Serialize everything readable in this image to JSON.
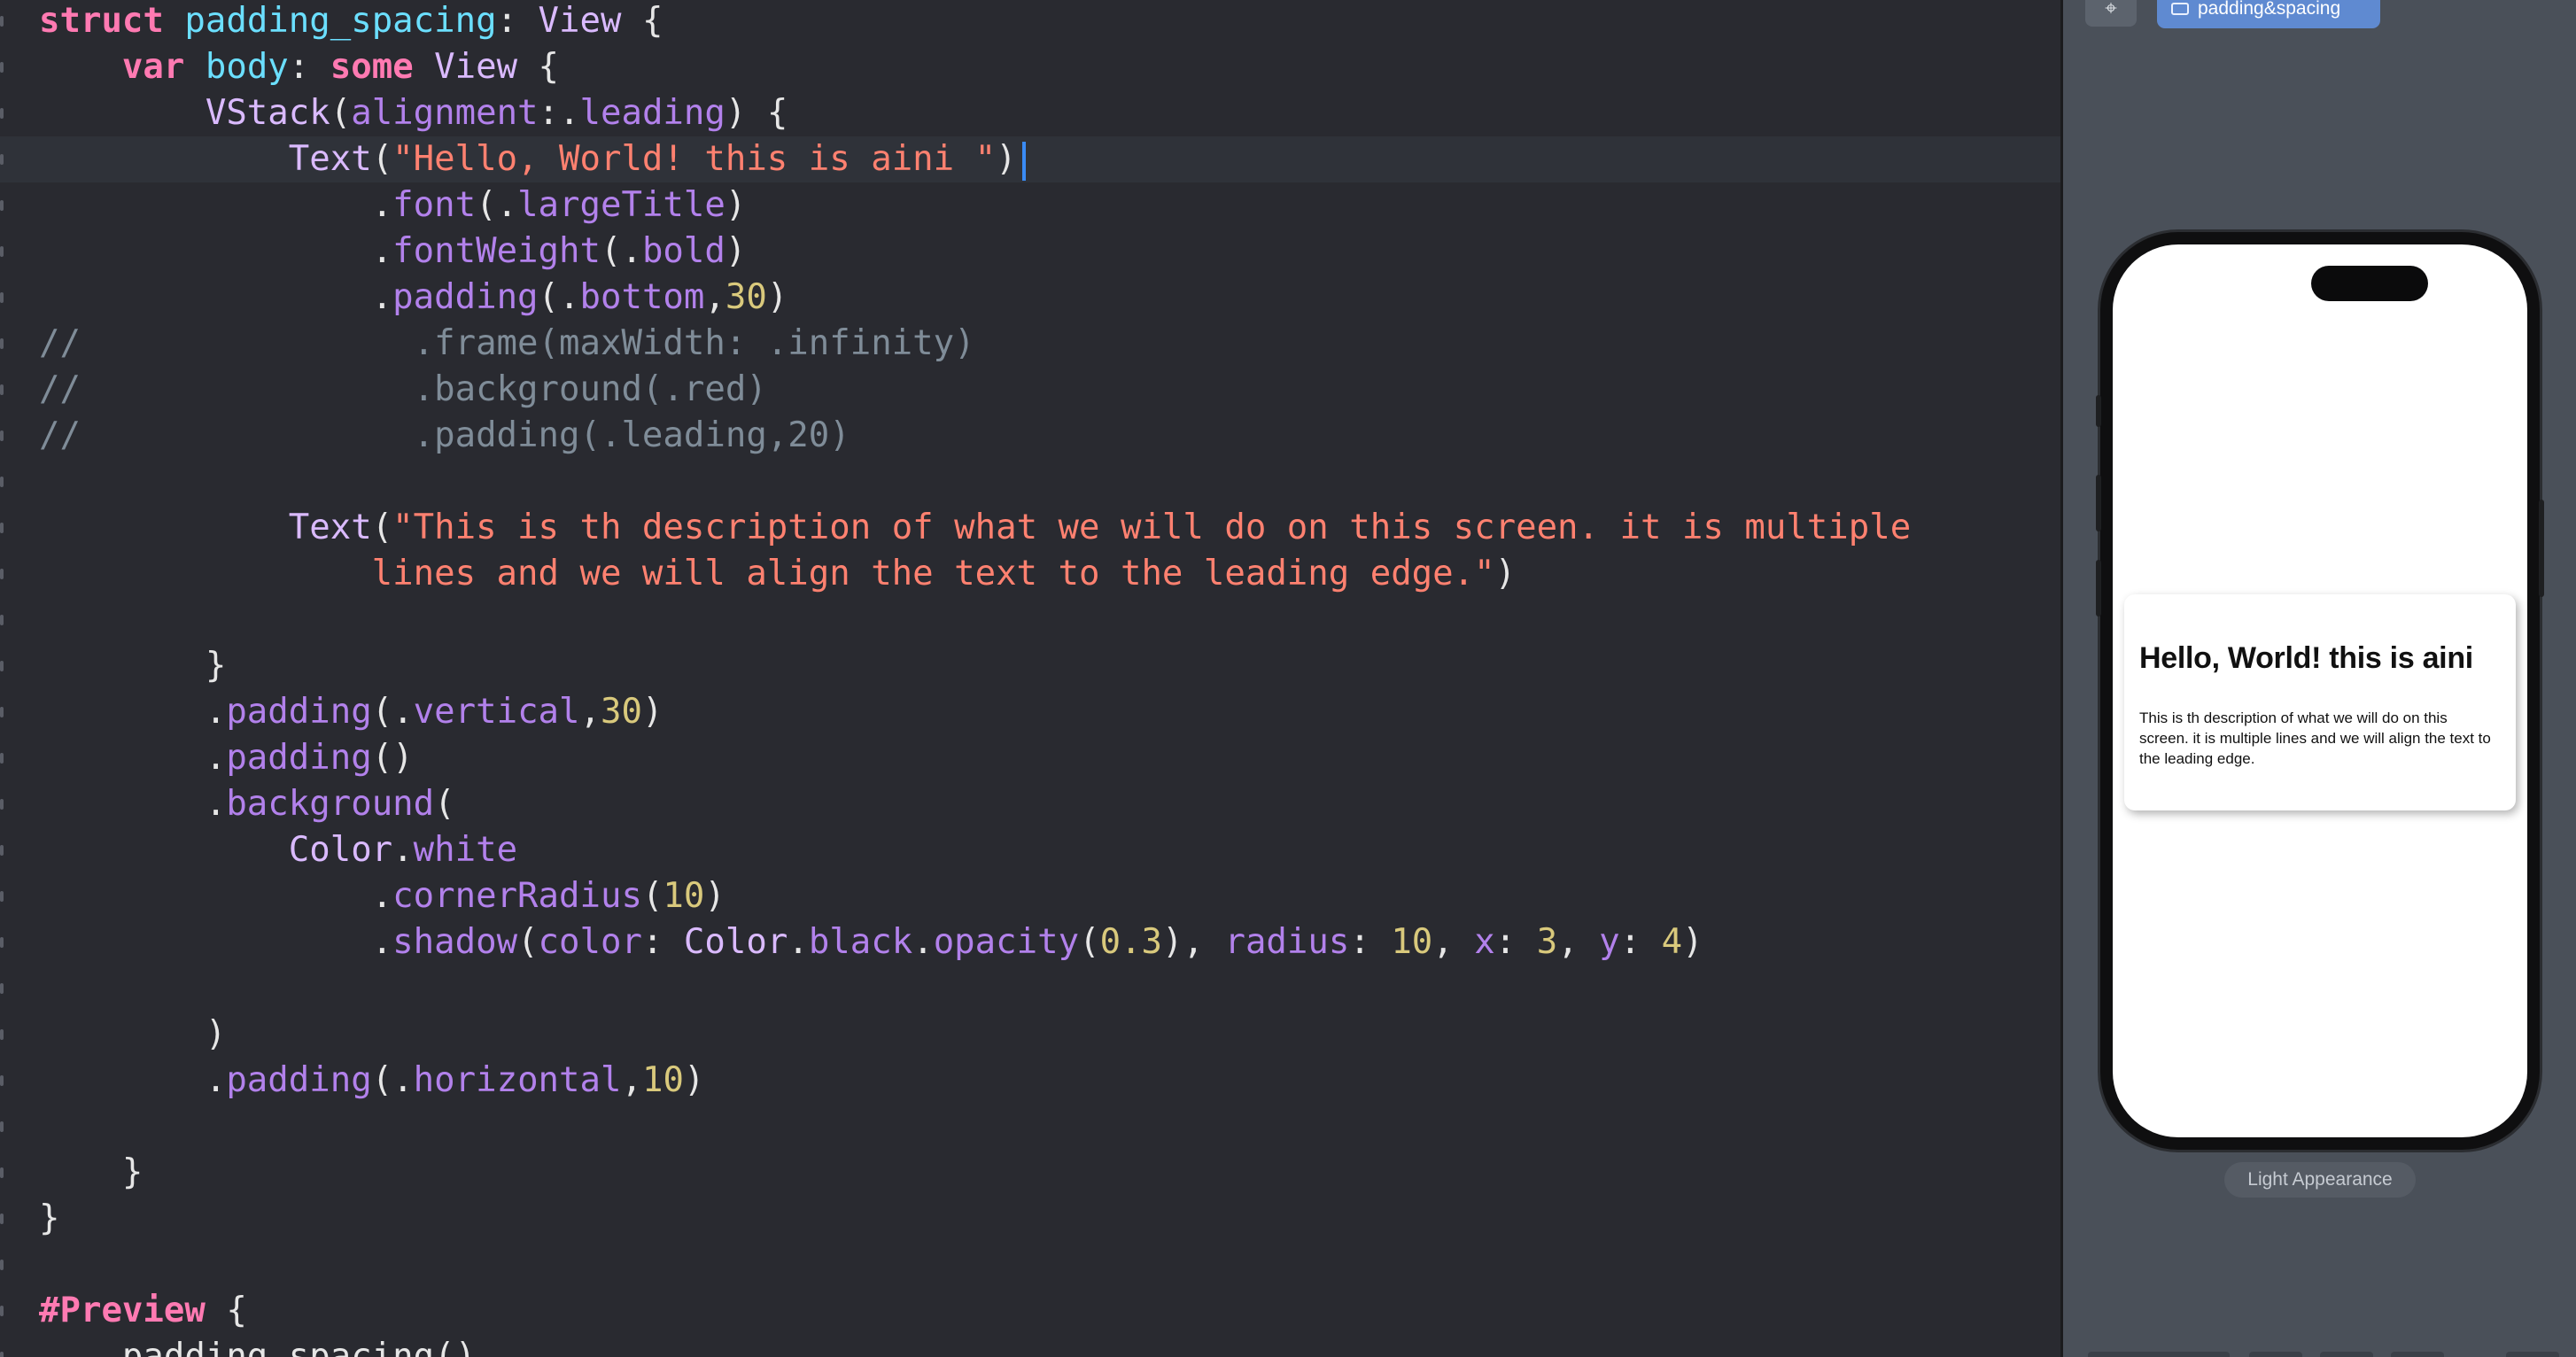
{
  "editor": {
    "lines": [
      {
        "tokens": [
          [
            "kw",
            "struct"
          ],
          [
            "def",
            " "
          ],
          [
            "type",
            "padding_spacing"
          ],
          [
            "def",
            ": "
          ],
          [
            "sys",
            "View"
          ],
          [
            "def",
            " {"
          ]
        ]
      },
      {
        "tokens": [
          [
            "def",
            "    "
          ],
          [
            "kw",
            "var"
          ],
          [
            "def",
            " "
          ],
          [
            "type",
            "body"
          ],
          [
            "def",
            ": "
          ],
          [
            "kw",
            "some"
          ],
          [
            "def",
            " "
          ],
          [
            "sys",
            "View"
          ],
          [
            "def",
            " {"
          ]
        ]
      },
      {
        "tokens": [
          [
            "def",
            "        "
          ],
          [
            "sys",
            "VStack"
          ],
          [
            "def",
            "("
          ],
          [
            "prop",
            "alignment"
          ],
          [
            "def",
            ":."
          ],
          [
            "prop",
            "leading"
          ],
          [
            "def",
            ") {"
          ]
        ]
      },
      {
        "tokens": [
          [
            "def",
            "            "
          ],
          [
            "sys",
            "Text"
          ],
          [
            "def",
            "("
          ],
          [
            "str",
            "\"Hello, World! this is aini \""
          ],
          [
            "def",
            ")"
          ]
        ],
        "current": true
      },
      {
        "tokens": [
          [
            "def",
            "                ."
          ],
          [
            "prop",
            "font"
          ],
          [
            "def",
            "(."
          ],
          [
            "prop",
            "largeTitle"
          ],
          [
            "def",
            ")"
          ]
        ]
      },
      {
        "tokens": [
          [
            "def",
            "                ."
          ],
          [
            "prop",
            "fontWeight"
          ],
          [
            "def",
            "(."
          ],
          [
            "prop",
            "bold"
          ],
          [
            "def",
            ")"
          ]
        ]
      },
      {
        "tokens": [
          [
            "def",
            "                ."
          ],
          [
            "prop",
            "padding"
          ],
          [
            "def",
            "(."
          ],
          [
            "prop",
            "bottom"
          ],
          [
            "def",
            ","
          ],
          [
            "num",
            "30"
          ],
          [
            "def",
            ")"
          ]
        ]
      },
      {
        "tokens": [
          [
            "com",
            "//                .frame(maxWidth: .infinity)"
          ]
        ]
      },
      {
        "tokens": [
          [
            "com",
            "//                .background(.red)"
          ]
        ]
      },
      {
        "tokens": [
          [
            "com",
            "//                .padding(.leading,20)"
          ]
        ]
      },
      {
        "tokens": []
      },
      {
        "tokens": [
          [
            "def",
            "            "
          ],
          [
            "sys",
            "Text"
          ],
          [
            "def",
            "("
          ],
          [
            "str",
            "\"This is th description of what we will do on this screen. it is multiple"
          ]
        ]
      },
      {
        "tokens": [
          [
            "str",
            "                lines and we will align the text to the leading edge.\""
          ],
          [
            "def",
            ")"
          ]
        ]
      },
      {
        "tokens": []
      },
      {
        "tokens": [
          [
            "def",
            "        }"
          ]
        ]
      },
      {
        "tokens": [
          [
            "def",
            "        ."
          ],
          [
            "prop",
            "padding"
          ],
          [
            "def",
            "(."
          ],
          [
            "prop",
            "vertical"
          ],
          [
            "def",
            ","
          ],
          [
            "num",
            "30"
          ],
          [
            "def",
            ")"
          ]
        ]
      },
      {
        "tokens": [
          [
            "def",
            "        ."
          ],
          [
            "prop",
            "padding"
          ],
          [
            "def",
            "()"
          ]
        ]
      },
      {
        "tokens": [
          [
            "def",
            "        ."
          ],
          [
            "prop",
            "background"
          ],
          [
            "def",
            "("
          ]
        ]
      },
      {
        "tokens": [
          [
            "def",
            "            "
          ],
          [
            "sys",
            "Color"
          ],
          [
            "def",
            "."
          ],
          [
            "prop",
            "white"
          ]
        ]
      },
      {
        "tokens": [
          [
            "def",
            "                ."
          ],
          [
            "prop",
            "cornerRadius"
          ],
          [
            "def",
            "("
          ],
          [
            "num",
            "10"
          ],
          [
            "def",
            ")"
          ]
        ]
      },
      {
        "tokens": [
          [
            "def",
            "                ."
          ],
          [
            "prop",
            "shadow"
          ],
          [
            "def",
            "("
          ],
          [
            "prop",
            "color"
          ],
          [
            "def",
            ": "
          ],
          [
            "sys",
            "Color"
          ],
          [
            "def",
            "."
          ],
          [
            "prop",
            "black"
          ],
          [
            "def",
            "."
          ],
          [
            "prop",
            "opacity"
          ],
          [
            "def",
            "("
          ],
          [
            "num",
            "0.3"
          ],
          [
            "def",
            "), "
          ],
          [
            "prop",
            "radius"
          ],
          [
            "def",
            ": "
          ],
          [
            "num",
            "10"
          ],
          [
            "def",
            ", "
          ],
          [
            "prop",
            "x"
          ],
          [
            "def",
            ": "
          ],
          [
            "num",
            "3"
          ],
          [
            "def",
            ", "
          ],
          [
            "prop",
            "y"
          ],
          [
            "def",
            ": "
          ],
          [
            "num",
            "4"
          ],
          [
            "def",
            ")"
          ]
        ]
      },
      {
        "tokens": []
      },
      {
        "tokens": [
          [
            "def",
            "        )"
          ]
        ]
      },
      {
        "tokens": [
          [
            "def",
            "        ."
          ],
          [
            "prop",
            "padding"
          ],
          [
            "def",
            "(."
          ],
          [
            "prop",
            "horizontal"
          ],
          [
            "def",
            ","
          ],
          [
            "num",
            "10"
          ],
          [
            "def",
            ")"
          ]
        ]
      },
      {
        "tokens": []
      },
      {
        "tokens": [
          [
            "def",
            "    }"
          ]
        ]
      },
      {
        "tokens": [
          [
            "def",
            "}"
          ]
        ]
      },
      {
        "tokens": []
      },
      {
        "tokens": [
          [
            "kw",
            "#Preview"
          ],
          [
            "def",
            " {"
          ]
        ]
      },
      {
        "tokens": [
          [
            "def",
            "    padding_spacing()"
          ]
        ]
      }
    ]
  },
  "canvas": {
    "pin_icon": "pin-icon",
    "pin_glyph": "⌖",
    "preview_tab_label": "padding&spacing",
    "card_title": "Hello, World! this is aini",
    "card_description": "This is th description of what we will do on this screen. it is multiple lines and we will align the text to the leading edge.",
    "appearance_label": "Light Appearance"
  }
}
